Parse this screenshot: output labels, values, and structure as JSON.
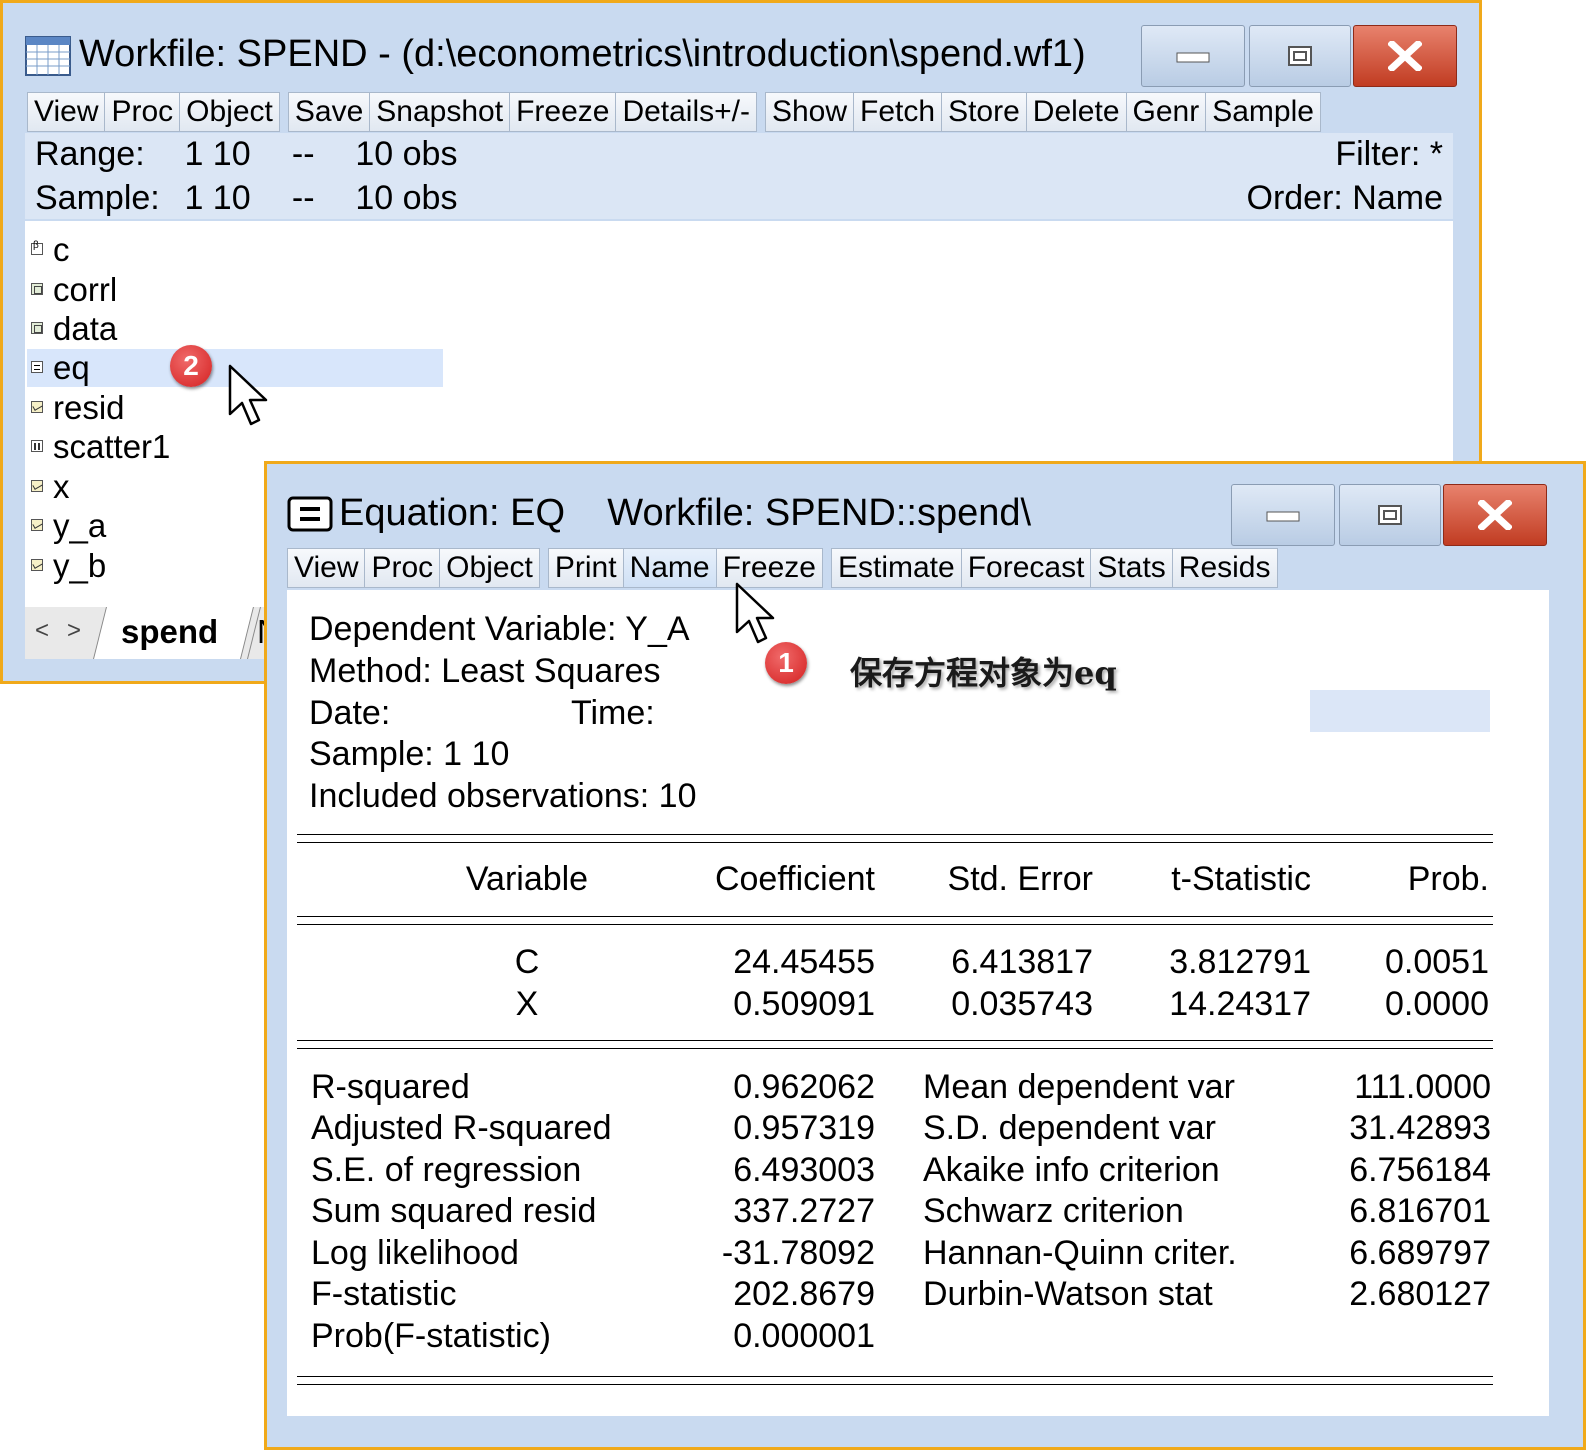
{
  "workfile_window": {
    "title": "Workfile: SPEND - (d:\\econometrics\\introduction\\spend.wf1)",
    "toolbar": [
      "View",
      "Proc",
      "Object",
      "Save",
      "Snapshot",
      "Freeze",
      "Details+/-",
      "Show",
      "Fetch",
      "Store",
      "Delete",
      "Genr",
      "Sample"
    ],
    "range_label": "Range:",
    "range_value": "1 10",
    "range_sep": "--",
    "range_obs": "10 obs",
    "sample_label": "Sample:",
    "sample_value": "1 10",
    "sample_sep": "--",
    "sample_obs": "10 obs",
    "filter": "Filter: *",
    "order": "Order: Name",
    "objects": [
      {
        "name": "c",
        "type": "coef-icon"
      },
      {
        "name": "corrl",
        "type": "group-icon"
      },
      {
        "name": "data",
        "type": "group-icon"
      },
      {
        "name": "eq",
        "type": "equation-icon",
        "selected": true
      },
      {
        "name": "resid",
        "type": "series-icon"
      },
      {
        "name": "scatter1",
        "type": "graph-icon"
      },
      {
        "name": "x",
        "type": "series-icon"
      },
      {
        "name": "y_a",
        "type": "series-icon"
      },
      {
        "name": "y_b",
        "type": "series-icon"
      }
    ],
    "tab_left": "<",
    "tab_right": ">",
    "active_tab": "spend",
    "next_tab": "N"
  },
  "equation_window": {
    "title": "Equation: EQ    Workfile: SPEND::spend\\",
    "toolbar": [
      "View",
      "Proc",
      "Object",
      "Print",
      "Name",
      "Freeze",
      "Estimate",
      "Forecast",
      "Stats",
      "Resids"
    ],
    "header": {
      "dependent": "Dependent Variable: Y_A",
      "method": "Method: Least Squares",
      "date_label": "Date:",
      "time_label": "Time:",
      "sample": "Sample: 1 10",
      "included": "Included observations: 10"
    },
    "columns": [
      "Variable",
      "Coefficient",
      "Std. Error",
      "t-Statistic",
      "Prob."
    ],
    "rows": [
      {
        "variable": "C",
        "coefficient": "24.45455",
        "std_error": "6.413817",
        "t_stat": "3.812791",
        "prob": "0.0051"
      },
      {
        "variable": "X",
        "coefficient": "0.509091",
        "std_error": "0.035743",
        "t_stat": "14.24317",
        "prob": "0.0000"
      }
    ],
    "stats_left": [
      {
        "label": "R-squared",
        "value": "0.962062"
      },
      {
        "label": "Adjusted R-squared",
        "value": "0.957319"
      },
      {
        "label": "S.E. of regression",
        "value": "6.493003"
      },
      {
        "label": "Sum squared resid",
        "value": "337.2727"
      },
      {
        "label": "Log likelihood",
        "value": "-31.78092"
      },
      {
        "label": "F-statistic",
        "value": "202.8679"
      },
      {
        "label": "Prob(F-statistic)",
        "value": "0.000001"
      }
    ],
    "stats_right": [
      {
        "label": "Mean dependent var",
        "value": "111.0000"
      },
      {
        "label": "S.D. dependent var",
        "value": "31.42893"
      },
      {
        "label": "Akaike info criterion",
        "value": "6.756184"
      },
      {
        "label": "Schwarz criterion",
        "value": "6.816701"
      },
      {
        "label": "Hannan-Quinn criter.",
        "value": "6.689797"
      },
      {
        "label": "Durbin-Watson stat",
        "value": "2.680127"
      }
    ]
  },
  "annotations": {
    "badge_1": "1",
    "badge_2": "2",
    "note": "保存方程对象为eq"
  },
  "colors": {
    "window_border": "#f0a91a",
    "window_frame": "#c9daf0",
    "close_button": "#c13c22",
    "selection": "#d8e6fb",
    "badge": "#d42020"
  }
}
